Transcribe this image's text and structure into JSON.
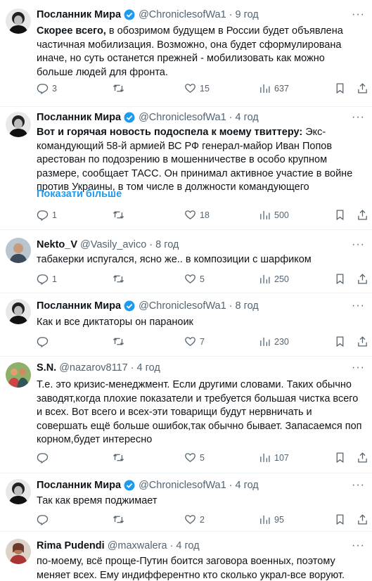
{
  "tweets": [
    {
      "name": "Посланник Мира",
      "handle": "@ChroniclesofWa1",
      "time": "9 год",
      "body_bold": "Скорее всего,",
      "body": " в обозримом будущем в России будет объявлена частичная мобилизация. Возможно, она будет сформулирована иначе, но суть останется прежней - мобилизовать как можно больше людей для фронта.",
      "replies": "3",
      "retweets": "",
      "likes": "15",
      "views": "637",
      "verified": true
    },
    {
      "name": "Посланник Мира",
      "handle": "@ChroniclesofWa1",
      "time": "4 год",
      "body_bold": "Вот и горячая новость подоспела к моему твиттеру:",
      "body": " Экс-командующий 58-й армией ВС РФ генерал-майор Иван Попов арестован по подозрению в мошенничестве в особо крупном размере, сообщает ТАСС. Он принимал активное участие в войне против Украины, в том числе в должности командующего",
      "show_more": "Показати більше",
      "replies": "1",
      "retweets": "",
      "likes": "18",
      "views": "500",
      "verified": true
    },
    {
      "name": "Nekto_V",
      "handle": "@Vasily_avico",
      "time": "8 год",
      "body_bold": "",
      "body": "табакерки испугался, ясно же.. в композиции с шарфиком",
      "replies": "1",
      "retweets": "",
      "likes": "5",
      "views": "250",
      "verified": false
    },
    {
      "name": "Посланник Мира",
      "handle": "@ChroniclesofWa1",
      "time": "8 год",
      "body_bold": "",
      "body": "Как и все диктаторы он параноик",
      "replies": "",
      "retweets": "",
      "likes": "7",
      "views": "230",
      "verified": true
    },
    {
      "name": "S.N.",
      "handle": "@nazarov8117",
      "time": "4 год",
      "body_bold": "",
      "body": "Т.е. это кризис-менеджмент. Если другими словами. Таких обычно заводят,когда плохие показатели и требуется большая чистка всего и всех. Вот всего и всех-эти товарищи будут нервничать и совершать ещё больше ошибок,так обычно бывает. Запасаемся поп корном,будет интересно",
      "replies": "",
      "retweets": "",
      "likes": "5",
      "views": "107",
      "verified": false
    },
    {
      "name": "Посланник Мира",
      "handle": "@ChroniclesofWa1",
      "time": "4 год",
      "body_bold": "",
      "body": "Так как время поджимает",
      "replies": "",
      "retweets": "",
      "likes": "2",
      "views": "95",
      "verified": true
    },
    {
      "name": "Rima Pudendi",
      "handle": "@maxwalera",
      "time": "4 год",
      "body_bold": "",
      "body": "по-моему, всё проще-Путин боится заговора военных, поэтому меняет всех. Ему индифферентно кто сколько украл-все воруют.",
      "verified": false
    }
  ],
  "icons": {
    "more": "more-dots-icon",
    "reply": "reply-icon",
    "retweet": "retweet-icon",
    "like": "heart-icon",
    "views": "views-icon",
    "bookmark": "bookmark-icon",
    "share": "share-icon",
    "verified": "verified-badge-icon"
  },
  "colors": {
    "accent": "#1d9bf0",
    "muted": "#536471",
    "text": "#0f1419",
    "divider": "#eff3f4"
  }
}
